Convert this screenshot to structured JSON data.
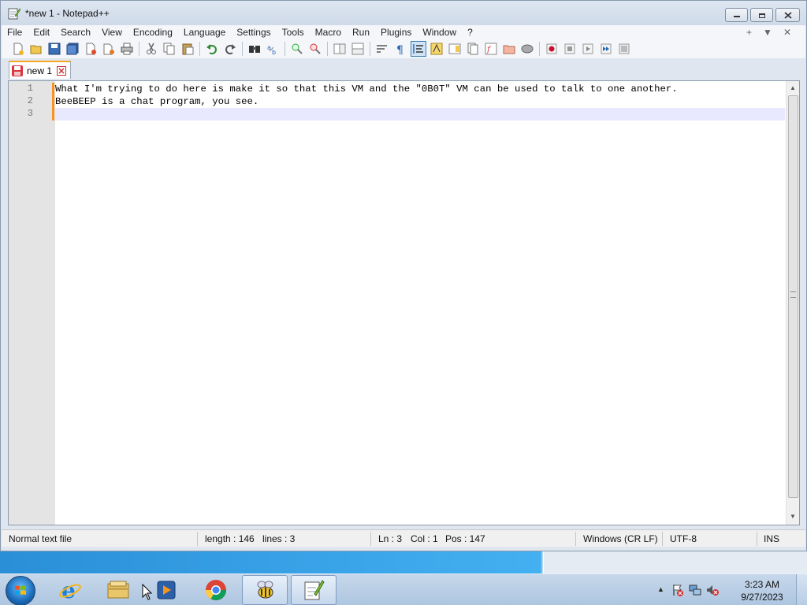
{
  "window": {
    "title": "*new 1 - Notepad++",
    "controls": [
      "minimize",
      "maximize",
      "close"
    ]
  },
  "menu": {
    "items": [
      "File",
      "Edit",
      "Search",
      "View",
      "Encoding",
      "Language",
      "Settings",
      "Tools",
      "Macro",
      "Run",
      "Plugins",
      "Window",
      "?"
    ],
    "right": [
      "+",
      "▼",
      "✕"
    ]
  },
  "toolbar": {
    "icons": [
      "new-file-icon",
      "open-file-icon",
      "save-icon",
      "save-all-icon",
      "close-icon",
      "close-all-icon",
      "print-icon",
      "cut-icon",
      "copy-icon",
      "paste-icon",
      "undo-icon",
      "redo-icon",
      "find-icon",
      "replace-icon",
      "zoom-in-icon",
      "zoom-out-icon",
      "sync-v-icon",
      "sync-h-icon",
      "word-wrap-icon",
      "show-all-chars-icon",
      "indent-guide-icon",
      "udl-icon",
      "doc-map-icon",
      "doc-list-icon",
      "function-list-icon",
      "folder-workspace-icon",
      "monitoring-icon",
      "record-macro-icon",
      "stop-macro-icon",
      "play-macro-icon",
      "run-macro-multiple-icon",
      "save-macro-icon"
    ]
  },
  "tabs": [
    {
      "label": "new 1",
      "icon": "unsaved-file-icon",
      "active": true
    }
  ],
  "editor": {
    "lines": [
      {
        "number": "1",
        "text": "What I'm trying to do here is make it so that this VM and the \"0B0T\" VM can be used to talk to one another."
      },
      {
        "number": "2",
        "text": "BeeBEEP is a chat program, you see."
      },
      {
        "number": "3",
        "text": ""
      }
    ],
    "current_line": 3,
    "colors": {
      "current_line": "#e8e8ff",
      "change_bar": "#f7931e",
      "gutter": "#e4e4e4"
    }
  },
  "status": {
    "file_type": "Normal text file",
    "length": "length : 146",
    "lines": "lines : 3",
    "ln": "Ln : 3",
    "col": "Col : 1",
    "pos": "Pos : 147",
    "eol": "Windows (CR LF)",
    "encoding": "UTF-8",
    "mode": "INS"
  },
  "taskbar": {
    "items": [
      "internet-explorer-icon",
      "file-explorer-icon",
      "media-player-icon",
      "chrome-icon",
      "beebeep-icon",
      "notepadpp-icon"
    ],
    "tray_icons": [
      "show-hidden-icons-arrow",
      "action-center-icon",
      "network-icon",
      "volume-muted-icon"
    ],
    "time": "3:23 AM",
    "date": "9/27/2023"
  }
}
